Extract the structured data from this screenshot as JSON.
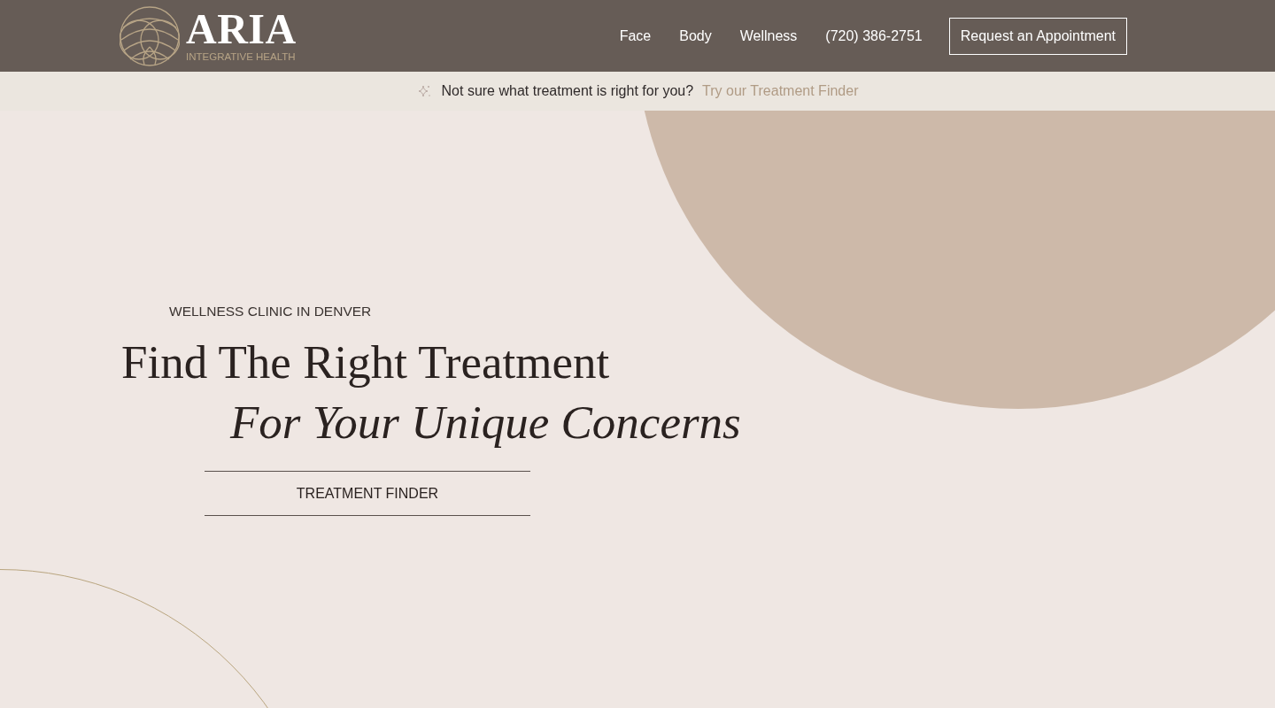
{
  "header": {
    "logo": {
      "name": "ARIA",
      "tagline": "INTEGRATIVE HEALTH"
    },
    "nav": [
      "Face",
      "Body",
      "Wellness"
    ],
    "phone": "(720) 386-2751",
    "cta": "Request an Appointment"
  },
  "banner": {
    "text": "Not sure what treatment is right for you?",
    "link": "Try our Treatment Finder"
  },
  "hero": {
    "eyebrow": "WELLNESS CLINIC IN DENVER",
    "heading_line_1": "Find The Right Treatment",
    "heading_line_2": "For Your Unique Concerns",
    "button": "TREATMENT FINDER"
  }
}
